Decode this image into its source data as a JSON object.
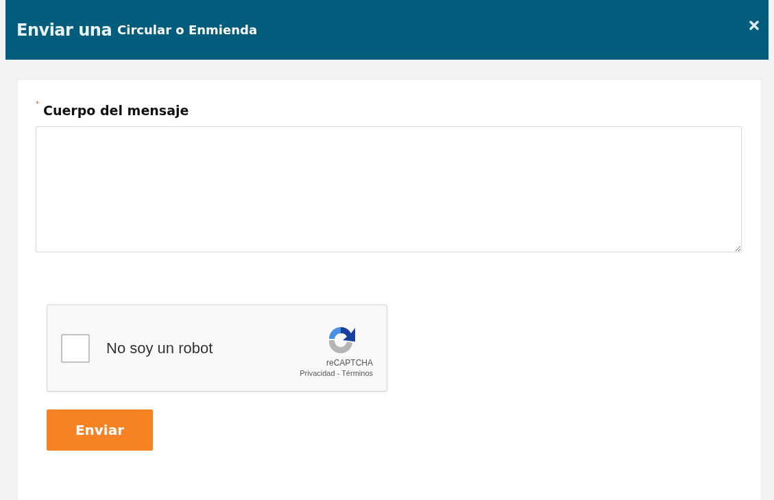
{
  "dialog": {
    "title": "Enviar una",
    "subtitle": "Circular o Enmienda"
  },
  "form": {
    "field_label": "Cuerpo del mensaje",
    "required_mark": "*"
  },
  "captcha": {
    "label": "No soy un robot",
    "checked": false,
    "brand": "reCAPTCHA",
    "links": "Privacidad - Términos"
  },
  "submit": {
    "label": "Enviar"
  }
}
